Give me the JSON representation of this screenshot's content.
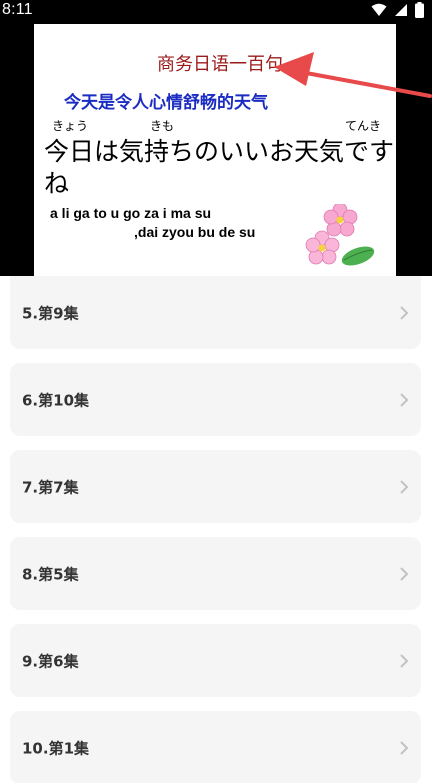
{
  "status_bar": {
    "time": "8:11"
  },
  "video": {
    "title": "商务日语一百句",
    "chinese": "今天是令人心情舒畅的天气",
    "furigana": [
      "きょう",
      "きも",
      "てんき"
    ],
    "japanese": "今日は気持ちのいいお天気ですね",
    "romaji_line1": "a li ga to u go za i ma su",
    "romaji_line2": ",dai zyou bu de su"
  },
  "episodes": [
    {
      "label": "5.第9集"
    },
    {
      "label": "6.第10集"
    },
    {
      "label": "7.第7集"
    },
    {
      "label": "8.第5集"
    },
    {
      "label": "9.第6集"
    },
    {
      "label": "10.第1集"
    }
  ],
  "colors": {
    "title_red": "#9a1a1a",
    "chinese_blue": "#1b2cc2",
    "arrow_red": "#e8494a",
    "card_bg": "#f5f5f5"
  }
}
